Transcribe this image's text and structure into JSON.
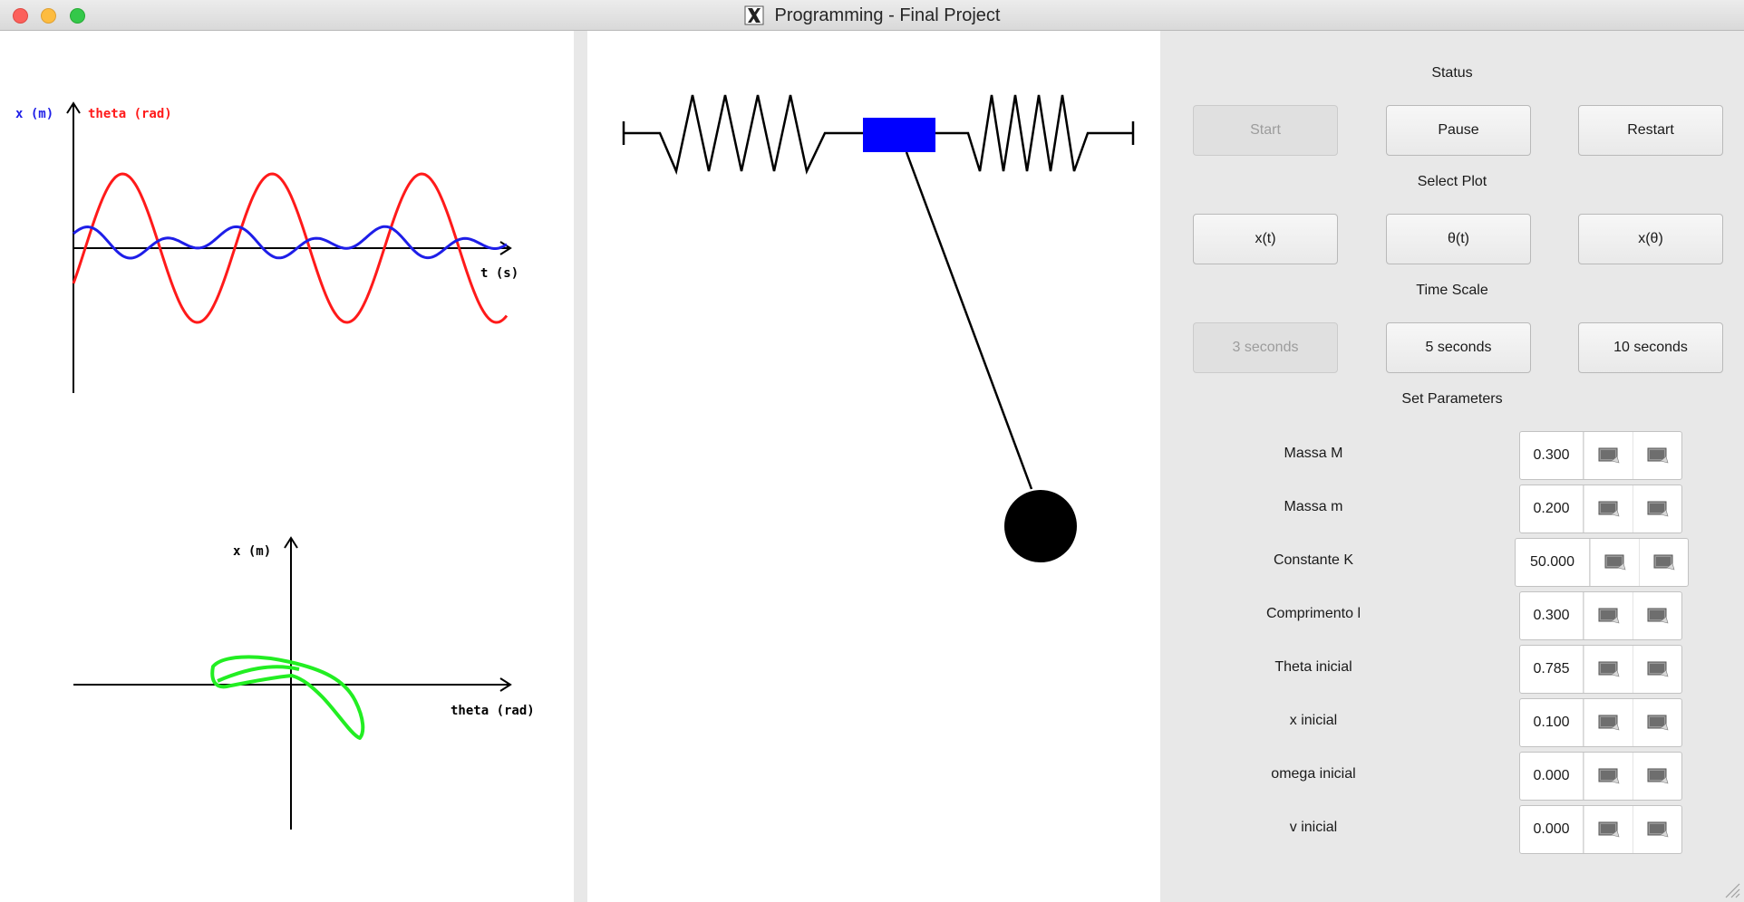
{
  "window": {
    "title": "Programming - Final Project"
  },
  "plot_top": {
    "y_label_left": "x (m)",
    "y_label_right": "theta (rad)",
    "x_label": "t (s)",
    "color_x": "#1e1ee8",
    "color_theta": "#ff1a1a"
  },
  "plot_bottom": {
    "y_label": "x (m)",
    "x_label": "theta (rad)",
    "color": "#22ee22"
  },
  "colors": {
    "cart": "#0000ff",
    "bob": "#000000"
  },
  "controls": {
    "status_label": "Status",
    "status_buttons": [
      {
        "label": "Start",
        "disabled": true
      },
      {
        "label": "Pause",
        "disabled": false
      },
      {
        "label": "Restart",
        "disabled": false
      }
    ],
    "plot_label": "Select Plot",
    "plot_buttons": [
      {
        "label": "x(t)",
        "disabled": false
      },
      {
        "label": "θ(t)",
        "disabled": false
      },
      {
        "label": "x(θ)",
        "disabled": false
      }
    ],
    "scale_label": "Time Scale",
    "scale_buttons": [
      {
        "label": "3 seconds",
        "disabled": true
      },
      {
        "label": "5 seconds",
        "disabled": false
      },
      {
        "label": "10 seconds",
        "disabled": false
      }
    ],
    "params_label": "Set Parameters",
    "params": [
      {
        "label": "Massa M",
        "value": "0.300"
      },
      {
        "label": "Massa m",
        "value": "0.200"
      },
      {
        "label": "Constante K",
        "value": "50.000"
      },
      {
        "label": "Comprimento l",
        "value": "0.300"
      },
      {
        "label": "Theta inicial",
        "value": "0.785"
      },
      {
        "label": "x inicial",
        "value": "0.100"
      },
      {
        "label": "omega inicial",
        "value": "0.000"
      },
      {
        "label": "v inicial",
        "value": "0.000"
      }
    ]
  }
}
